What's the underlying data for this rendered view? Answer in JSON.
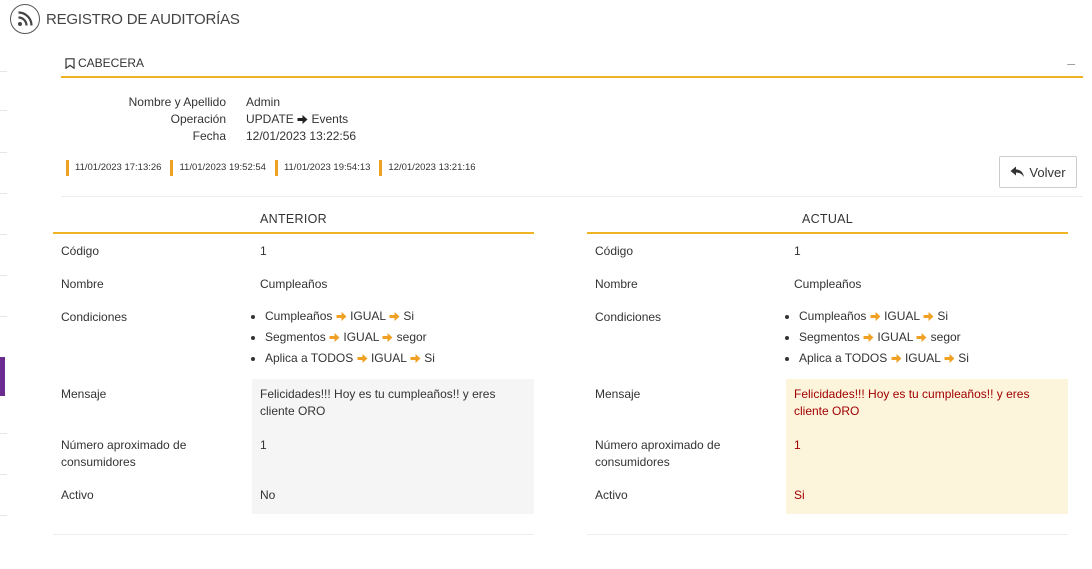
{
  "page": {
    "title": "REGISTRO DE AUDITORÍAS"
  },
  "header": {
    "title": "CABECERA",
    "collapse_label": "–",
    "fields": [
      {
        "label": "Nombre y Apellido",
        "value": "Admin"
      },
      {
        "label": "Operación",
        "value_before": "UPDATE",
        "value_after": "Events"
      },
      {
        "label": "Fecha",
        "value": "12/01/2023 13:22:56"
      }
    ]
  },
  "history": [
    "11/01/2023 17:13:26",
    "11/01/2023 19:52:54",
    "11/01/2023 19:54:13",
    "12/01/2023 13:21:16"
  ],
  "back_button": {
    "label": "Volver"
  },
  "anterior": {
    "title": "ANTERIOR",
    "codigo_label": "Código",
    "codigo": "1",
    "nombre_label": "Nombre",
    "nombre": "Cumpleaños",
    "condiciones_label": "Condiciones",
    "condiciones": [
      {
        "a": "Cumpleaños",
        "b": "IGUAL",
        "c": "Si"
      },
      {
        "a": "Segmentos",
        "b": "IGUAL",
        "c": "segor"
      },
      {
        "a": "Aplica a TODOS",
        "b": "IGUAL",
        "c": "Si"
      }
    ],
    "mensaje_label": "Mensaje",
    "mensaje": "Felicidades!!! Hoy es tu cumpleaños!! y eres cliente ORO",
    "numero_label": "Número aproximado de consumidores",
    "numero": "1",
    "activo_label": "Activo",
    "activo": "No"
  },
  "actual": {
    "title": "ACTUAL",
    "codigo_label": "Código",
    "codigo": "1",
    "nombre_label": "Nombre",
    "nombre": "Cumpleaños",
    "condiciones_label": "Condiciones",
    "condiciones": [
      {
        "a": "Cumpleaños",
        "b": "IGUAL",
        "c": "Si"
      },
      {
        "a": "Segmentos",
        "b": "IGUAL",
        "c": "segor"
      },
      {
        "a": "Aplica a TODOS",
        "b": "IGUAL",
        "c": "Si"
      }
    ],
    "mensaje_label": "Mensaje",
    "mensaje": "Felicidades!!! Hoy es tu cumpleaños!! y eres cliente ORO",
    "numero_label": "Número aproximado de consumidores",
    "numero": "1",
    "activo_label": "Activo",
    "activo": "Si"
  },
  "colors": {
    "accent": "#f0b323",
    "arrow": "#f0a023",
    "previous_bg": "#f5f5f5",
    "changed_bg": "#fdf4dc",
    "changed_text": "#a10000",
    "sidebar_accent": "#6a2c91"
  }
}
